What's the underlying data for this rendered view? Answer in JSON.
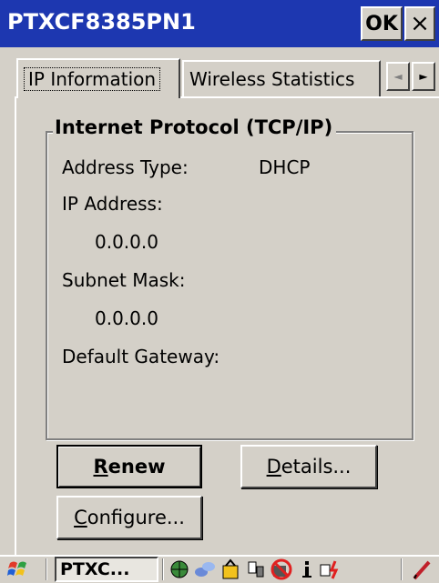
{
  "window": {
    "title": "PTXCF8385PN1",
    "ok_label": "OK",
    "close_label": "×"
  },
  "tabs": [
    {
      "label": "IP Information"
    },
    {
      "label": "Wireless Statistics"
    }
  ],
  "tab_scroll": {
    "left": "◄",
    "right": "►"
  },
  "group": {
    "title": "Internet Protocol (TCP/IP)",
    "address_type_label": "Address Type:",
    "address_type_value": "DHCP",
    "ip_address_label": "IP Address:",
    "ip_address_value": "0.0.0.0",
    "subnet_mask_label": "Subnet Mask:",
    "subnet_mask_value": "0.0.0.0",
    "default_gateway_label": "Default Gateway:",
    "default_gateway_value": ""
  },
  "buttons": {
    "renew": {
      "mnemonic": "R",
      "rest": "enew"
    },
    "details": {
      "mnemonic": "D",
      "rest": "etails..."
    },
    "configure": {
      "mnemonic": "C",
      "rest": "onfigure..."
    }
  },
  "taskbar": {
    "task_label": "PTXC...",
    "icons": [
      "start-icon",
      "network-icon",
      "connectivity-icon",
      "battery-icon",
      "device-icon",
      "no-signal-icon",
      "info-icon",
      "power-icon",
      "pen-icon"
    ]
  }
}
